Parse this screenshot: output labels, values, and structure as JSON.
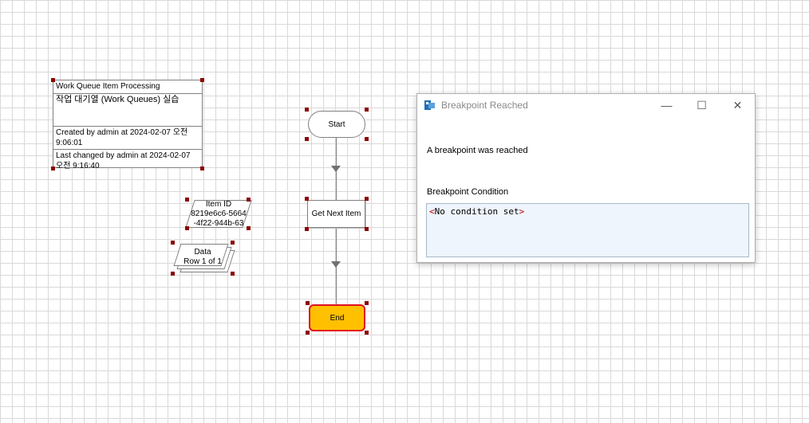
{
  "info_box": {
    "title": "Work Queue Item Processing",
    "description": "작업 대기열 (Work Queues) 실습",
    "created": "Created  by  admin  at  2024-02-07  오전 9:06:01",
    "changed": "Last changed by admin at 2024-02-07 오전 9:16:40"
  },
  "flow": {
    "start_label": "Start",
    "get_next_label": "Get Next Item",
    "end_label": "End"
  },
  "item_id": {
    "line1": "Item ID",
    "line2": "8219e6c6-5664",
    "line3": "-4f22-944b-63"
  },
  "data_stage": {
    "line1": "Data",
    "line2": "Row 1 of 1"
  },
  "dialog": {
    "title": "Breakpoint Reached",
    "message": "A breakpoint was reached",
    "condition_label": "Breakpoint Condition",
    "condition_open": "<",
    "condition_value": "No condition set",
    "condition_close": ">",
    "minimize_glyph": "—",
    "maximize_glyph": "☐",
    "close_glyph": "✕"
  },
  "colors": {
    "end_fill": "#ffc000",
    "end_border": "#e01020",
    "handle": "#8b0000",
    "grid": "#d9d9d9"
  }
}
